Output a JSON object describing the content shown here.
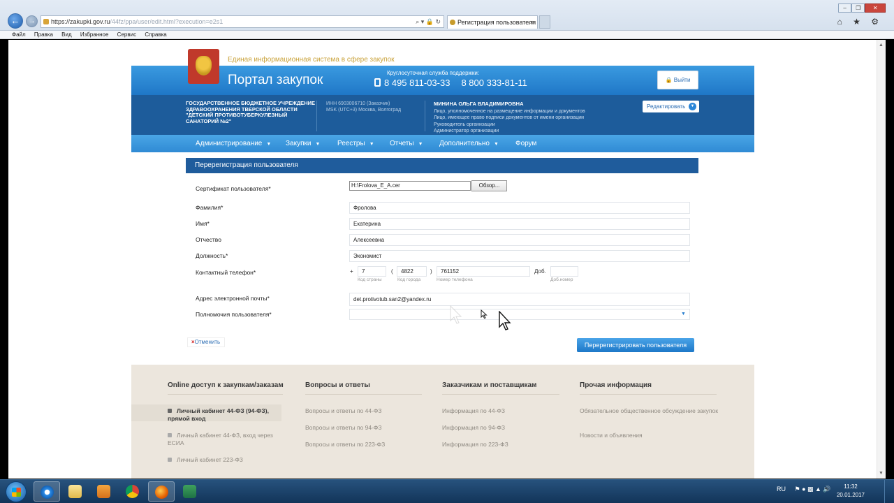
{
  "browser": {
    "url_main": "https://zakupki.gov.ru",
    "url_tail": "/44fz/ppa/user/edit.html?execution=e2s1",
    "tab_title": "Регистрация пользователя",
    "tab_close": "×",
    "menu": [
      "Файл",
      "Правка",
      "Вид",
      "Избранное",
      "Сервис",
      "Справка"
    ],
    "addr_icons": "⌕ ▾ 🔒 ↻",
    "window_controls": [
      "–",
      "❐",
      "✕"
    ],
    "tool_icons": "⌂ ★ ⚙"
  },
  "header": {
    "tagline": "Единая информационная система в сфере закупок",
    "portal_title": "Портал закупок",
    "support_label": "Круглосуточная служба поддержки:",
    "phone1": "8 495 811-03-33",
    "phone2": "8 800 333-81-11",
    "exit_label": "Выйти"
  },
  "org": {
    "name": "Государственное бюджетное учреждение здравоохранения Тверской области \"Детский противотуберкулезный санаторий №2\"",
    "inn": "ИНН 6903006710 (Заказчик)",
    "tz": "MSK (UTC+3) Москва, Волгоград",
    "person_name": "МИНИНА ОЛЬГА ВЛАДИМИРОВНА",
    "roles": [
      "Лицо, уполномоченное на размещение информации и документов",
      "Лицо, имеющее право подписи документов от имени организации",
      "Руководитель организации",
      "Администратор организации"
    ],
    "edit_label": "Редактировать"
  },
  "nav": {
    "items": [
      "Администрирование",
      "Закупки",
      "Реестры",
      "Отчеты",
      "Дополнительно",
      "Форум"
    ],
    "caret": "▼"
  },
  "form": {
    "title": "Перерегистрация пользователя",
    "cert_label": "Сертификат пользователя*",
    "cert_value": "H:\\Frolova_E_A.cer",
    "browse_label": "Обзор...",
    "surname_label": "Фамилия*",
    "surname": "Фролова",
    "name_label": "Имя*",
    "name": "Екатерина",
    "patronymic_label": "Отчество",
    "patronymic": "Алексеевна",
    "position_label": "Должность*",
    "position": "Экономист",
    "phone_label": "Контактный телефон*",
    "phone_plus": "+",
    "phone_country": "7",
    "phone_open": "(",
    "phone_city": "4822",
    "phone_close": ")",
    "phone_number": "761152",
    "ext_label": "Доб.",
    "ext_value": "",
    "hint_country": "Код страны",
    "hint_city": "Код города",
    "hint_number": "Номер телефона",
    "hint_ext": "Доб.номер",
    "email_label": "Адрес электронной почты*",
    "email": "det.protivotub.san2@yandex.ru",
    "rights_label": "Полномочия пользователя*",
    "rights_value": "",
    "cancel_label": "Отменить",
    "cancel_x": "×",
    "submit_label": "Перерегистрировать пользователя"
  },
  "footer": {
    "columns": [
      {
        "title": "Online доступ к закупкам/заказам",
        "items": [
          "Личный кабинет 44-ФЗ (94-ФЗ), прямой вход",
          "Личный кабинет 44-ФЗ, вход через ЕСИА",
          "Личный кабинет 223-ФЗ"
        ]
      },
      {
        "title": "Вопросы и ответы",
        "items": [
          "Вопросы и ответы по 44-ФЗ",
          "Вопросы и ответы по 94-ФЗ",
          "Вопросы и ответы по 223-ФЗ"
        ]
      },
      {
        "title": "Заказчикам и поставщикам",
        "items": [
          "Информация по 44-ФЗ",
          "Информация по 94-ФЗ",
          "Информация по 223-ФЗ"
        ]
      },
      {
        "title": "Прочая информация",
        "items": [
          "Обязательное общественное обсуждение закупок",
          "Новости и объявления"
        ]
      }
    ]
  },
  "taskbar": {
    "lang": "RU",
    "time": "11:32",
    "date": "20.01.2017",
    "apps": [
      "internet-explorer",
      "file-explorer",
      "media-player",
      "chrome",
      "firefox",
      "excel"
    ]
  },
  "colors": {
    "header_blue": "#2a86d8",
    "dark_blue": "#1d5c9b",
    "footer_beige": "#ece6dd",
    "accent_gold": "#c9a23a"
  }
}
